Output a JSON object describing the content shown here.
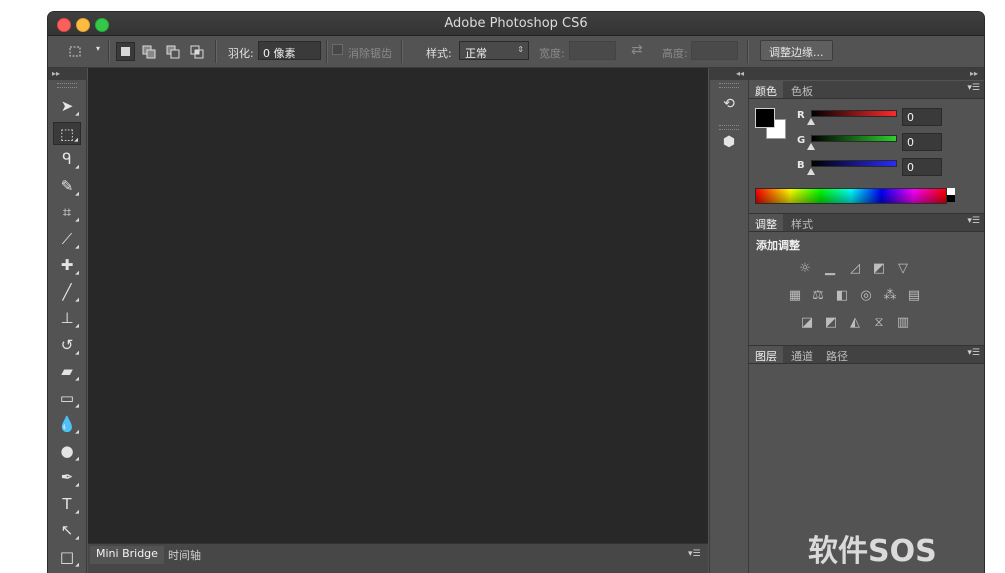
{
  "window": {
    "title": "Adobe Photoshop CS6"
  },
  "options_bar": {
    "feather_label": "羽化:",
    "feather_value": "0 像素",
    "antialias_label": "消除锯齿",
    "style_label": "样式:",
    "style_value": "正常",
    "width_label": "宽度:",
    "width_value": "",
    "height_label": "高度:",
    "height_value": "",
    "refine_edge_label": "调整边缘..."
  },
  "toolbox": {
    "collapse_glyph": "▸▸",
    "tools": [
      {
        "name": "move-tool",
        "glyph": "➤"
      },
      {
        "name": "rectangular-marquee-tool",
        "glyph": "⬚"
      },
      {
        "name": "lasso-tool",
        "glyph": "ᑫ"
      },
      {
        "name": "quick-selection-tool",
        "glyph": "✎"
      },
      {
        "name": "crop-tool",
        "glyph": "⌗"
      },
      {
        "name": "eyedropper-tool",
        "glyph": "⟋"
      },
      {
        "name": "healing-brush-tool",
        "glyph": "✚"
      },
      {
        "name": "brush-tool",
        "glyph": "╱"
      },
      {
        "name": "clone-stamp-tool",
        "glyph": "⊥"
      },
      {
        "name": "history-brush-tool",
        "glyph": "↺"
      },
      {
        "name": "eraser-tool",
        "glyph": "▰"
      },
      {
        "name": "gradient-tool",
        "glyph": "▭"
      },
      {
        "name": "blur-tool",
        "glyph": "💧"
      },
      {
        "name": "dodge-tool",
        "glyph": "●"
      },
      {
        "name": "pen-tool",
        "glyph": "✒"
      },
      {
        "name": "type-tool",
        "glyph": "T"
      },
      {
        "name": "path-selection-tool",
        "glyph": "↖"
      },
      {
        "name": "rectangle-tool",
        "glyph": "□"
      }
    ]
  },
  "bottom_dock": {
    "tabs": [
      "Mini Bridge",
      "时间轴"
    ]
  },
  "color_panel": {
    "tabs": [
      "颜色",
      "色板"
    ],
    "r_label": "R",
    "g_label": "G",
    "b_label": "B",
    "r_value": "0",
    "g_value": "0",
    "b_value": "0",
    "colors": {
      "r": "#ff2a2a",
      "g": "#2ecf2e",
      "b": "#2a2aff"
    }
  },
  "adjustments_panel": {
    "tabs": [
      "调整",
      "样式"
    ],
    "title": "添加调整"
  },
  "layers_panel": {
    "tabs": [
      "图层",
      "通道",
      "路径"
    ]
  },
  "watermark": {
    "text": "软件SOS"
  }
}
